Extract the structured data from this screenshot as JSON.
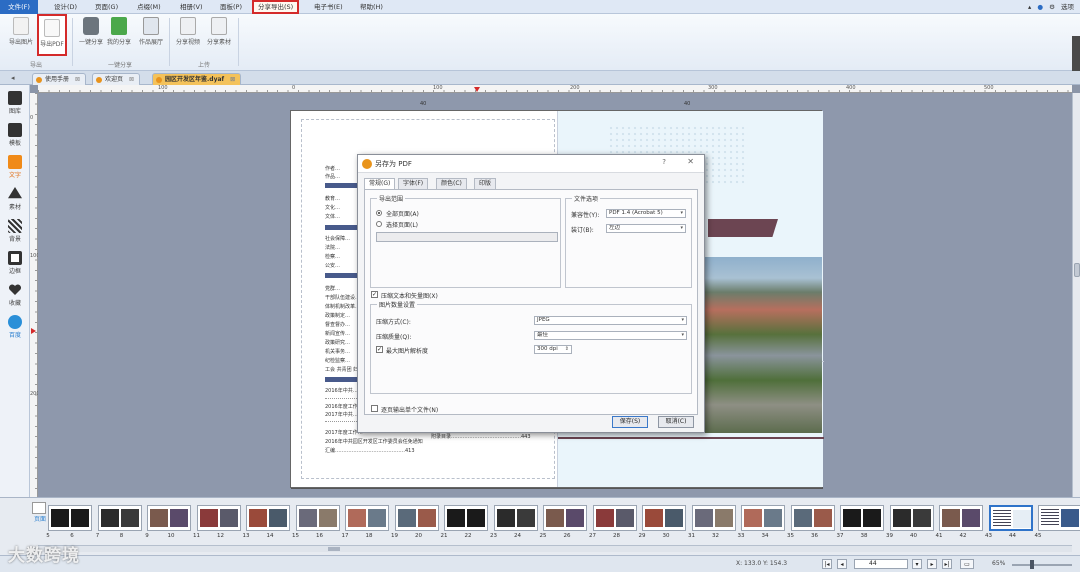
{
  "menubar": {
    "file": "文件(F)",
    "items": [
      "设计(D)",
      "页面(G)",
      "点缀(M)",
      "相册(V)",
      "面板(P)",
      "分享导出(S)",
      "电子书(E)",
      "帮助(H)"
    ],
    "right": [
      "选项"
    ]
  },
  "ribbon": {
    "buttons": [
      "导出图片",
      "导出PDF",
      "一键分享",
      "我的分享",
      "作品展厅",
      "分享视频",
      "分享素材"
    ],
    "groups": [
      "导出",
      "一键分享",
      "上传"
    ]
  },
  "tabs": [
    "使用手册",
    "欢迎页",
    "园区开发区年鉴.dyaf"
  ],
  "sidebar": [
    "图库",
    "模板",
    "文字",
    "素材",
    "背景",
    "边框",
    "收藏",
    "百度"
  ],
  "rulers": {
    "h": [
      "100",
      "0",
      "100",
      "200",
      "300",
      "400",
      "500"
    ],
    "v": [
      "0",
      "100",
      "200",
      "300",
      "400"
    ],
    "hmid": [
      "40",
      "40"
    ]
  },
  "page_left": {
    "lines_top": [
      "作者…",
      "作品…"
    ],
    "lines_mid": [
      "教育…",
      "文化…",
      "文体…"
    ],
    "lines_mid2": [
      "社会保障…",
      "法院…",
      "检察…",
      "公安…"
    ],
    "lines_long": [
      "党群…",
      "干部队伍建设…",
      "体制机制改革…",
      "政策制定…",
      "督查督办…",
      "新闻宣传…",
      "政策研究…",
      "机关事务…",
      "纪检监察…",
      "工会 共青团 妇联…"
    ],
    "notes": [
      "2016年中共…",
      "2016年度工作…",
      "2017年中共…",
      "2017年度工作…",
      "2018年中共…"
    ],
    "notes2": [
      "2016年中共园区开发区工作委员会任免通知",
      "汇编……………………………………413"
    ],
    "mid_label": "附录目录……………………………………443"
  },
  "dialog": {
    "title": "另存为 PDF",
    "help": "?",
    "close": "✕",
    "tabs": [
      "常规(G)",
      "字体(F)",
      "颜色(C)",
      "印版"
    ],
    "range": {
      "legend": "导出范围",
      "all": "全部页面(A)",
      "selected": "选择页面(L)"
    },
    "doc": {
      "legend": "文件选项",
      "compat_label": "兼容性(Y):",
      "compat_value": "PDF 1.4 (Acrobat 5)",
      "bind_label": "装订(B):",
      "bind_value": "左边"
    },
    "compress_text": "压缩文本和矢量图(X)",
    "image": {
      "legend": "图片数量设置",
      "method_label": "压缩方式(C):",
      "method_value": "JPEG",
      "quality_label": "压缩质量(Q):",
      "quality_value": "最佳",
      "maxres_label": "最大图片解析度",
      "maxres_value": "300 dpi"
    },
    "single_file": "逐页输出单个文件(N)",
    "save": "保存(S)",
    "cancel": "取消(C)"
  },
  "thumbs": {
    "label": "页面",
    "numbers": [
      "5",
      "6",
      "7",
      "8",
      "9",
      "10",
      "11",
      "12",
      "13",
      "14",
      "15",
      "16",
      "17",
      "18",
      "19",
      "20",
      "21",
      "22",
      "23",
      "24",
      "25",
      "26",
      "27",
      "28",
      "29",
      "30",
      "31",
      "32",
      "33",
      "34",
      "35",
      "36",
      "37",
      "38",
      "39",
      "40",
      "41",
      "42",
      "43",
      "44",
      "45"
    ]
  },
  "status": {
    "coords": "X: 133.0    Y: 154.3",
    "page": "44",
    "zoom": "65%"
  },
  "watermark": "大数跨境",
  "colors": {
    "accent": "#2b6cc4",
    "highlight": "#d42a2a",
    "maroon": "#6c4552"
  }
}
